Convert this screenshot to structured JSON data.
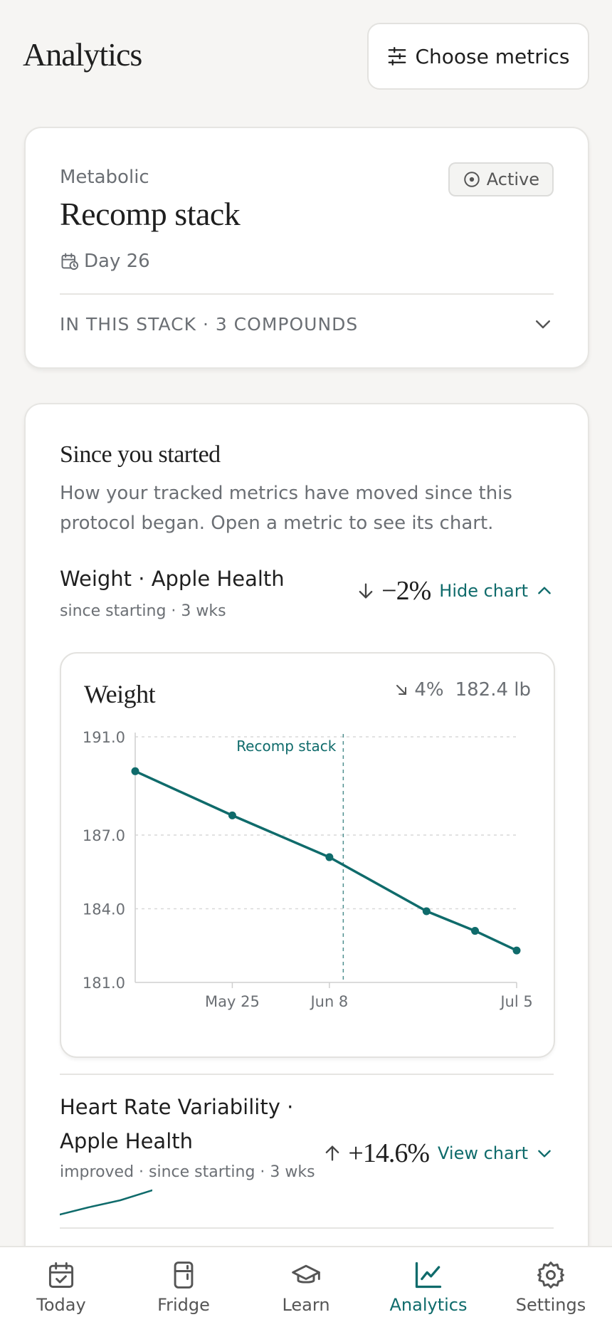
{
  "header": {
    "title": "Analytics",
    "metrics_button": "Choose metrics"
  },
  "stack": {
    "category": "Metabolic",
    "name": "Recomp stack",
    "status": "Active",
    "day": "Day 26",
    "compounds_label": "IN THIS STACK · 3 COMPOUNDS"
  },
  "since": {
    "title": "Since you started",
    "description": "How your tracked metrics have moved since this protocol began. Open a metric to see its chart."
  },
  "metrics": [
    {
      "title": "Weight · Apple Health",
      "subtitle": "since starting · 3 wks",
      "delta": "−2%",
      "direction": "down",
      "action": "Hide chart",
      "expanded": true
    },
    {
      "title_line1": "Heart Rate Variability ·",
      "title_line2": "Apple Health",
      "subtitle": "improved · since starting · 3 wks",
      "delta": "+14.6%",
      "direction": "up",
      "action": "View chart",
      "expanded": false
    }
  ],
  "chart": {
    "name": "Weight",
    "change": "4%",
    "current": "182.4 lb"
  },
  "chart_data": {
    "type": "line",
    "title": "Weight",
    "y_ticks": [
      "191.0",
      "187.0",
      "184.0",
      "181.0"
    ],
    "x_ticks": [
      "May 25",
      "Jun 8",
      "Jul 5"
    ],
    "ylim": [
      181,
      191
    ],
    "series": [
      {
        "values": [
          {
            "x": "2024-05-11",
            "y": 189.6
          },
          {
            "x": "2024-05-25",
            "y": 187.8
          },
          {
            "x": "2024-06-08",
            "y": 186.1
          },
          {
            "x": "2024-06-22",
            "y": 183.9
          },
          {
            "x": "2024-06-29",
            "y": 183.1
          },
          {
            "x": "2024-07-05",
            "y": 182.3
          }
        ]
      }
    ],
    "annotation": {
      "label": "Recomp stack",
      "x": "2024-06-10"
    },
    "grid": true,
    "color": "#0f6b6b"
  },
  "nav": [
    {
      "label": "Today",
      "icon": "calendar-check-icon",
      "active": false
    },
    {
      "label": "Fridge",
      "icon": "fridge-icon",
      "active": false
    },
    {
      "label": "Learn",
      "icon": "graduation-cap-icon",
      "active": false
    },
    {
      "label": "Analytics",
      "icon": "line-chart-icon",
      "active": true
    },
    {
      "label": "Settings",
      "icon": "gear-icon",
      "active": false
    }
  ],
  "colors": {
    "accent": "#0f6b6b",
    "background": "#f6f5f3"
  }
}
